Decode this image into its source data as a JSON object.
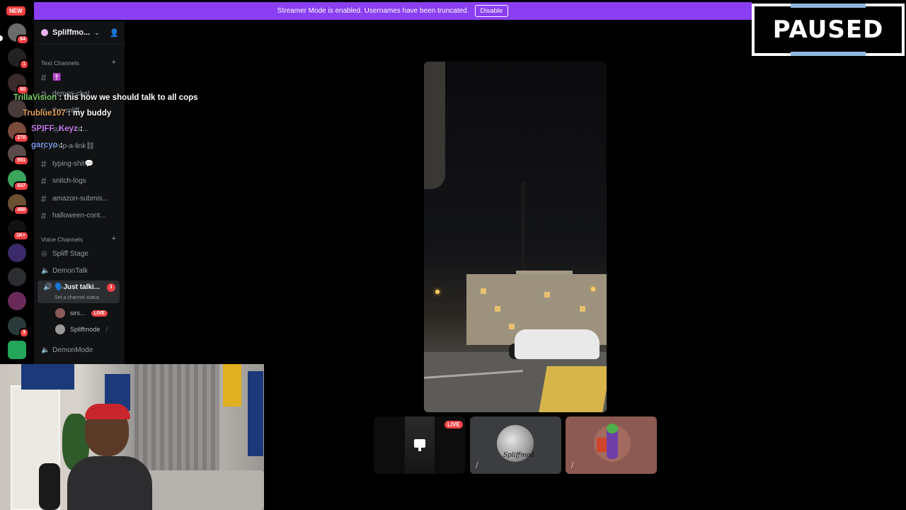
{
  "banner": {
    "message": "Streamer Mode is enabled. Usernames have been truncated.",
    "disable_label": "Disable",
    "color": "#8a3ff2"
  },
  "overlay": {
    "paused_label": "PAUSED"
  },
  "server_rail": {
    "new_label": "NEW",
    "servers": [
      {
        "badge": "64",
        "color": "#6b6b6b"
      },
      {
        "badge": "1",
        "color": "#222222"
      },
      {
        "badge": "60",
        "color": "#3b2a2a"
      },
      {
        "badge": "",
        "color": "#4a3b3b"
      },
      {
        "badge": "270",
        "color": "#7a4a3a"
      },
      {
        "badge": "551",
        "color": "#5a4a4a"
      },
      {
        "badge": "637",
        "color": "#3ba55c"
      },
      {
        "badge": "450",
        "color": "#6a5030"
      },
      {
        "badge": "1K+",
        "color": "#111111"
      },
      {
        "badge": "",
        "color": "#3a2a6a"
      },
      {
        "badge": "",
        "color": "#2b2d31"
      },
      {
        "badge": "",
        "color": "#6a2a5a"
      },
      {
        "badge": "3",
        "color": "#2a3a3a"
      },
      {
        "badge": "",
        "color": "#23a55a"
      }
    ]
  },
  "sidebar": {
    "server_name": "Spliffmo...",
    "text_category": "Text Channels",
    "text_channels": [
      {
        "name": "✝️"
      },
      {
        "name": "demon-chat"
      },
      {
        "name": "the-spliff"
      },
      {
        "name": "sub-missi..."
      },
      {
        "name": "drop-a-link⛓"
      },
      {
        "name": "typing-shit💬"
      },
      {
        "name": "snitch-logs"
      },
      {
        "name": "amazon-submis..."
      },
      {
        "name": "halloween-cont..."
      }
    ],
    "voice_category": "Voice Channels",
    "voice_channels": {
      "stage": "Spliff Stage",
      "demontalk": "DemonTalk",
      "active": {
        "name": "🗣️Just talki...",
        "badge": "1",
        "status": "Set a channel status"
      },
      "members": [
        {
          "name": "sirs...",
          "live": "LIVE"
        },
        {
          "name": "Spliffmode"
        }
      ],
      "demonmode": "DemonMode"
    }
  },
  "chat": [
    {
      "user": "TrillaVision",
      "msg": ": this how we should talk to all cops",
      "color": "#7dd36a"
    },
    {
      "user": "Trublue107",
      "msg": ": my buddy",
      "color": "#e8a25a"
    },
    {
      "user": "SPIFF_Keyz",
      "msg": ":",
      "color": "#c07ae8"
    },
    {
      "user": "garcyo",
      "msg": ":",
      "color": "#7a9ae8"
    }
  ],
  "stream": {
    "tiles": [
      {
        "live": "LIVE"
      },
      {
        "signature": "Spliffmod"
      },
      {}
    ]
  }
}
